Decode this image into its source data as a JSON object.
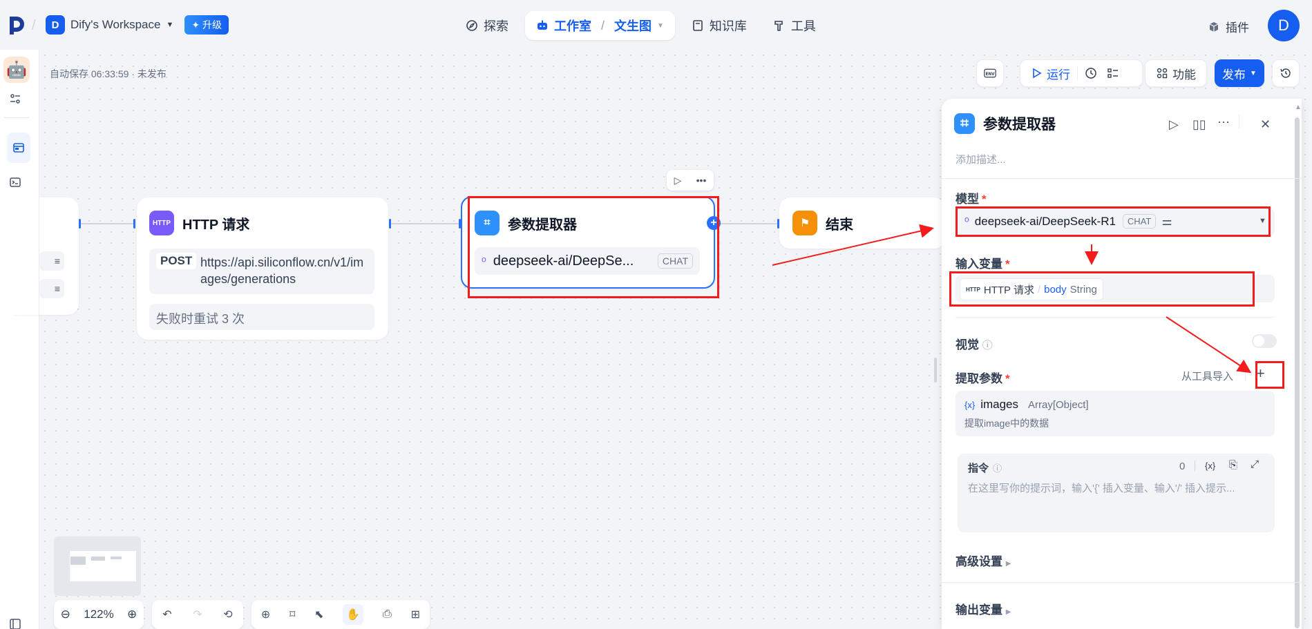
{
  "header": {
    "workspace_initial": "D",
    "workspace_name": "Dify's Workspace",
    "upgrade_label": "✦ 升级",
    "nav": {
      "explore": "探索",
      "studio": "工作室",
      "studio_sub": "文生图",
      "knowledge": "知识库",
      "tools": "工具"
    },
    "plugins_label": "插件",
    "user_initial": "D"
  },
  "canvas": {
    "autosave_text": "自动保存 06:33:59 · 未发布",
    "env_label": "ENV",
    "run_label": "运行",
    "features_label": "功能",
    "publish_label": "发布"
  },
  "nodes": {
    "http": {
      "icon_text": "HTTP",
      "title": "HTTP 请求",
      "method": "POST",
      "url": "https://api.siliconflow.cn/v1/images/generations",
      "retry": "失败时重试 3 次"
    },
    "extractor": {
      "title": "参数提取器",
      "model": "deepseek-ai/DeepSe...",
      "model_tag": "CHAT"
    },
    "end": {
      "title": "结束"
    }
  },
  "panel": {
    "title": "参数提取器",
    "description_placeholder": "添加描述...",
    "model_label": "模型",
    "model_value": "deepseek-ai/DeepSeek-R1",
    "model_tag": "CHAT",
    "input_label": "输入变量",
    "input_chip_icon": "HTTP",
    "input_chip_node": "HTTP 请求",
    "input_chip_sep": "/",
    "input_chip_var": "body",
    "input_chip_type": "String",
    "vision_label": "视觉",
    "extract_label": "提取参数",
    "import_label": "从工具导入",
    "add_label": "+",
    "param_prefix": "{x}",
    "param_name": "images",
    "param_type": "Array[Object]",
    "param_desc": "提取image中的数据",
    "instruction_label": "指令",
    "instruction_count": "0",
    "instruction_var_icon": "{x}",
    "instruction_placeholder": "在这里写你的提示词，输入'{' 插入变量、输入'/' 插入提示...",
    "advanced_label": "高级设置",
    "output_label": "输出变量",
    "required_mark": "*"
  },
  "controls": {
    "zoom": "122%"
  },
  "colors": {
    "accent": "#155eef",
    "annotation_red": "#f31b1b"
  }
}
